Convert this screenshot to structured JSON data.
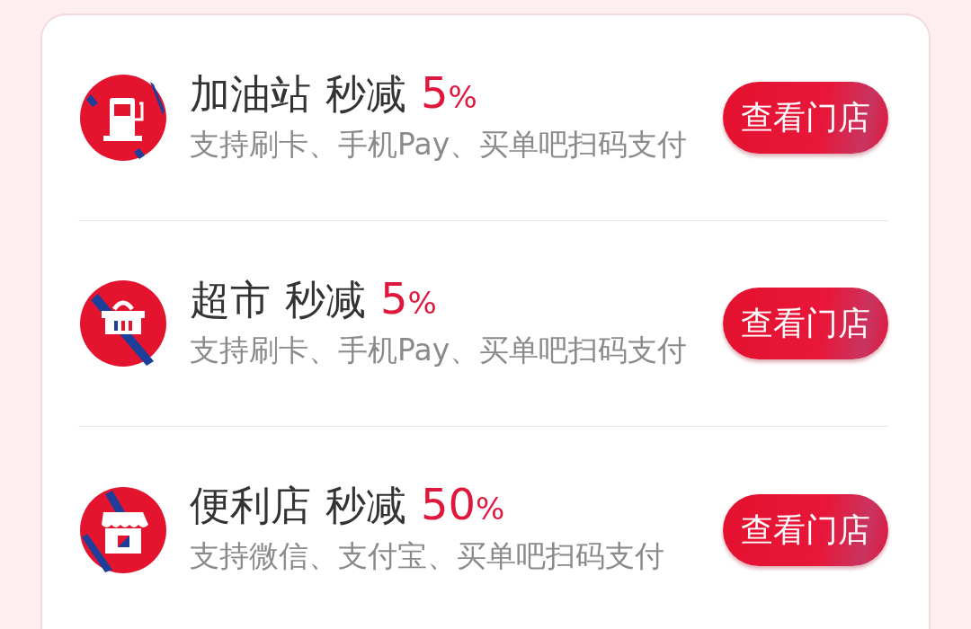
{
  "stores": [
    {
      "kind": "pump",
      "name": "加油站",
      "label": "秒减",
      "discount": "5",
      "unit": "%",
      "methods": "支持刷卡、手机Pay、买单吧扫码支付",
      "button": "查看门店"
    },
    {
      "kind": "basket",
      "name": "超市",
      "label": "秒减",
      "discount": "5",
      "unit": "%",
      "methods": "支持刷卡、手机Pay、买单吧扫码支付",
      "button": "查看门店"
    },
    {
      "kind": "store",
      "name": "便利店",
      "label": "秒减",
      "discount": "50",
      "unit": "%",
      "methods": "支持微信、支付宝、买单吧扫码支付",
      "button": "查看门店"
    }
  ]
}
